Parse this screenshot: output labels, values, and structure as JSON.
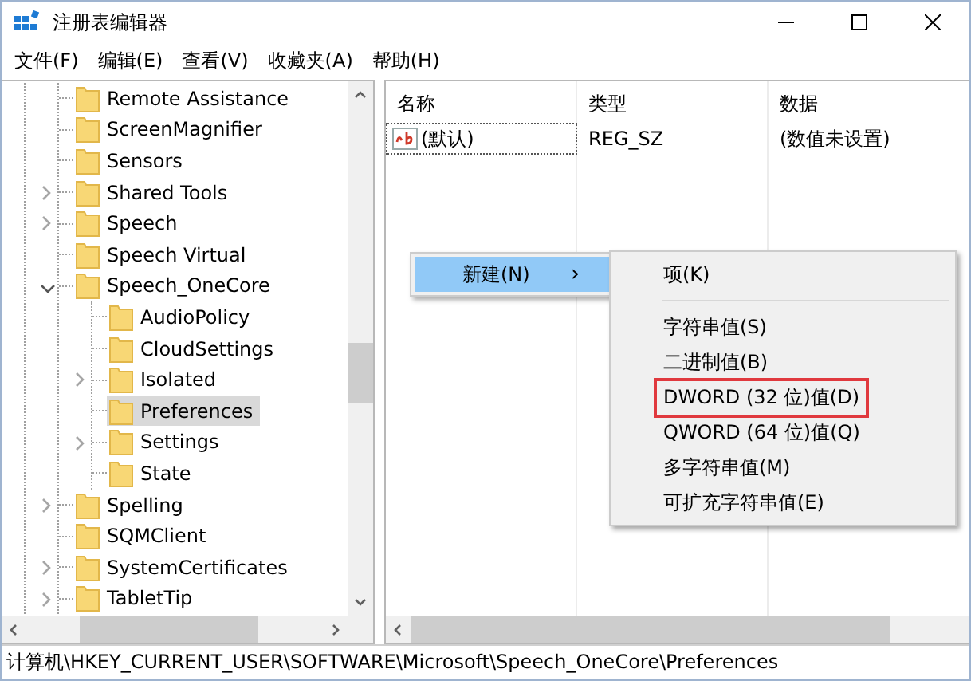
{
  "window": {
    "title": "注册表编辑器"
  },
  "menu_bar": [
    "文件(F)",
    "编辑(E)",
    "查看(V)",
    "收藏夹(A)",
    "帮助(H)"
  ],
  "tree": [
    {
      "label": "Remote Assistance",
      "selected": false
    },
    {
      "label": "ScreenMagnifier",
      "selected": false
    },
    {
      "label": "Sensors",
      "selected": false
    },
    {
      "label": "Shared Tools",
      "expanded": false,
      "selected": false
    },
    {
      "label": "Speech",
      "expanded": false,
      "selected": false
    },
    {
      "label": "Speech Virtual",
      "selected": false
    },
    {
      "label": "Speech_OneCore",
      "expanded": true,
      "selected": false,
      "children": [
        {
          "label": "AudioPolicy",
          "selected": false
        },
        {
          "label": "CloudSettings",
          "selected": false
        },
        {
          "label": "Isolated",
          "expanded": false,
          "selected": false
        },
        {
          "label": "Preferences",
          "selected": true
        },
        {
          "label": "Settings",
          "expanded": false,
          "selected": false
        },
        {
          "label": "State",
          "selected": false
        }
      ]
    },
    {
      "label": "Spelling",
      "expanded": false,
      "selected": false
    },
    {
      "label": "SQMClient",
      "selected": false
    },
    {
      "label": "SystemCertificates",
      "expanded": false,
      "selected": false
    },
    {
      "label": "TabletTip",
      "expanded": false,
      "selected": false
    }
  ],
  "table": {
    "columns": [
      "名称",
      "类型",
      "数据"
    ],
    "rows": [
      {
        "name": "(默认)",
        "type": "REG_SZ",
        "data": "(数值未设置)"
      }
    ]
  },
  "context_menu": {
    "items": [
      {
        "label": "新建(N)",
        "arrow": "›",
        "selected": true
      }
    ]
  },
  "submenu": {
    "items": [
      {
        "kind": "item",
        "label": "项(K)",
        "annotated": false
      },
      {
        "kind": "separator"
      },
      {
        "kind": "item",
        "label": "字符串值(S)",
        "annotated": false
      },
      {
        "kind": "item",
        "label": "二进制值(B)",
        "annotated": false
      },
      {
        "kind": "item",
        "label": "DWORD (32 位)值(D)",
        "annotated": true
      },
      {
        "kind": "item",
        "label": "QWORD (64 位)值(Q)",
        "annotated": false
      },
      {
        "kind": "item",
        "label": "多字符串值(M)",
        "annotated": false
      },
      {
        "kind": "item",
        "label": "可扩充字符串值(E)",
        "annotated": false
      }
    ]
  },
  "status_bar": "计算机\\HKEY_CURRENT_USER\\SOFTWARE\\Microsoft\\Speech_OneCore\\Preferences"
}
